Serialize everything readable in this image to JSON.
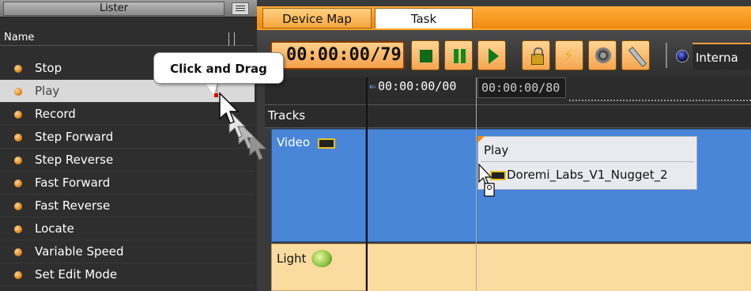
{
  "lister": {
    "title": "Lister",
    "column_header": "Name",
    "items": [
      {
        "label": "Stop",
        "selected": false
      },
      {
        "label": "Play",
        "selected": true
      },
      {
        "label": "Record",
        "selected": false
      },
      {
        "label": "Step Forward",
        "selected": false
      },
      {
        "label": "Step Reverse",
        "selected": false
      },
      {
        "label": "Fast Forward",
        "selected": false
      },
      {
        "label": "Fast Reverse",
        "selected": false
      },
      {
        "label": "Locate",
        "selected": false
      },
      {
        "label": "Variable Speed",
        "selected": false
      },
      {
        "label": "Set Edit Mode",
        "selected": false
      }
    ]
  },
  "tabs": [
    {
      "label": "Device Map",
      "active": false
    },
    {
      "label": "Task",
      "active": true
    }
  ],
  "toolbar": {
    "timecode": "00:00:00/79",
    "buttons": [
      "stop",
      "pause",
      "play",
      "lock",
      "flash",
      "film-reel",
      "wrench"
    ],
    "sync_source": "Interna"
  },
  "ruler": {
    "start": "00:00:00/00",
    "marker": "00:00:00/80"
  },
  "tracks": {
    "header": "Tracks",
    "video": {
      "label": "Video",
      "color": "#4a86d8"
    },
    "light": {
      "label": "Light",
      "color": "#fbdca0"
    }
  },
  "event": {
    "title": "Play",
    "clip": "Doremi_Labs_V1_Nugget_2"
  },
  "callout": {
    "text": "Click and Drag"
  },
  "colors": {
    "accent_orange": "#f08a10",
    "selected_item": "#d9d9d9",
    "video_track": "#4a86d8",
    "light_track": "#fbdca0"
  }
}
